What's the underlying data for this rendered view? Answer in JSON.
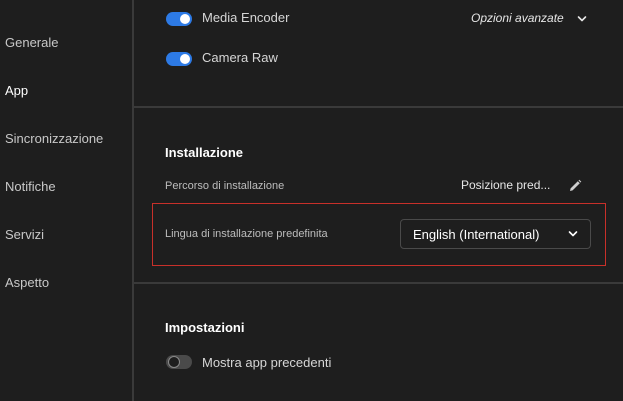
{
  "sidebar": {
    "items": [
      {
        "label": "Generale"
      },
      {
        "label": "App"
      },
      {
        "label": "Sincronizzazione"
      },
      {
        "label": "Notifiche"
      },
      {
        "label": "Servizi"
      },
      {
        "label": "Aspetto"
      }
    ],
    "active_index": 1
  },
  "apps": {
    "items": [
      {
        "label": "Media Encoder",
        "enabled": true
      },
      {
        "label": "Camera Raw",
        "enabled": true
      }
    ],
    "advanced_options_label": "Opzioni avanzate"
  },
  "installation": {
    "title": "Installazione",
    "path_label": "Percorso di installazione",
    "path_value": "Posizione pred...",
    "language_label": "Lingua di installazione predefinita",
    "language_value": "English (International)"
  },
  "settings": {
    "title": "Impostazioni",
    "show_previous_label": "Mostra app precedenti",
    "show_previous_enabled": false
  },
  "colors": {
    "accent": "#2d7ae5",
    "highlight": "#c8302a",
    "background": "#1e1e1e"
  }
}
